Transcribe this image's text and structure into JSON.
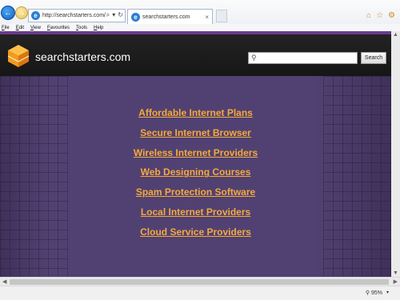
{
  "browser": {
    "address": "http://searchstarters.com/",
    "tab_title": "searchstarters.com",
    "tab_close": "×",
    "addr_tools": [
      "⌕",
      "▾",
      "↻"
    ],
    "menu": [
      {
        "first": "F",
        "rest": "ile"
      },
      {
        "first": "E",
        "rest": "dit"
      },
      {
        "first": "V",
        "rest": "iew"
      },
      {
        "first": "F",
        "rest": "avourites"
      },
      {
        "first": "T",
        "rest": "ools"
      },
      {
        "first": "H",
        "rest": "elp"
      }
    ],
    "window_icons": [
      "home-icon",
      "star-icon",
      "gear-icon"
    ],
    "zoom": "95%"
  },
  "site": {
    "name": "searchstarters.com",
    "search_placeholder": "",
    "search_button": "Search",
    "links": [
      "Affordable Internet Plans",
      "Secure Internet Browser",
      "Wireless Internet Providers",
      "Web Designing Courses",
      "Spam Protection Software",
      "Local Internet Providers",
      "Cloud Service Providers"
    ]
  },
  "colors": {
    "link": "#f5a93b",
    "page_background": "#514172",
    "header": "#1c1c1c",
    "accent_line": "#6b3a8e"
  }
}
